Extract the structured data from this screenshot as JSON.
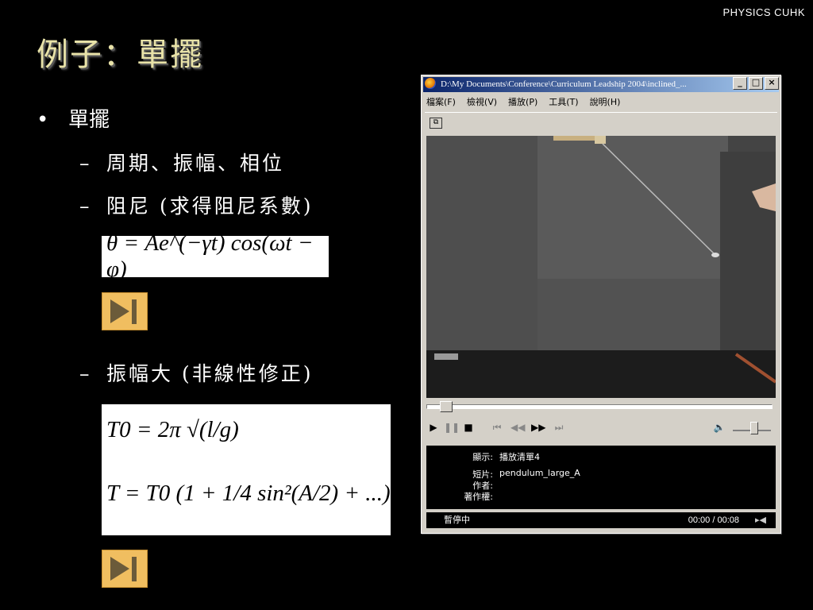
{
  "header": {
    "label": "PHYSICS  CUHK"
  },
  "slide": {
    "title": "例子：單擺",
    "bullet1": {
      "marker": "•",
      "text": "單擺"
    },
    "sub1": {
      "marker": "–",
      "text": "周期、振幅、相位"
    },
    "sub2": {
      "marker": "–",
      "text": "阻尼 (求得阻尼系數)"
    },
    "sub3": {
      "marker": "–",
      "text": "振幅大 (非線性修正)"
    },
    "eq1": "θ = Ae^(−γt) cos(ωt − φ)",
    "eq2_row1": "T0 = 2π √(l/g)",
    "eq2_row2": "T = T0 (1 + 1/4 sin²(A/2) + ...)"
  },
  "player": {
    "title": "D:\\My Documents\\Conference\\Curriculum Leadship 2004\\inclined_...",
    "menu": [
      "檔案(F)",
      "檢視(V)",
      "播放(P)",
      "工具(T)",
      "說明(H)"
    ],
    "info": {
      "show_label": "顯示:",
      "show_value": "播放清單4",
      "clip_label": "短片:",
      "clip_value": "pendulum_large_A",
      "author_label": "作者:",
      "author_value": "",
      "copyright_label": "著作權:",
      "copyright_value": ""
    },
    "status": "暫停中",
    "time": "00:00 / 00:08",
    "seek_progress": 0.04,
    "volume": 0.55
  },
  "colors": {
    "title": "#e8e2a8",
    "button": "#f0be60",
    "accent": "#0a246a"
  }
}
